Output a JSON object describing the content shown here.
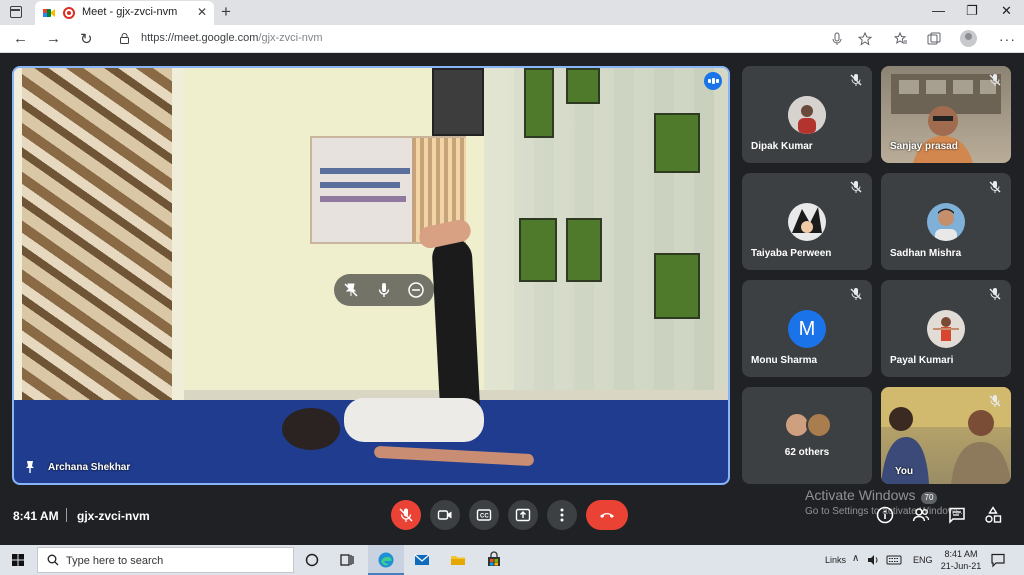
{
  "browser": {
    "tab_title": "Meet - gjx-zvci-nvm",
    "tab_close": "✕",
    "new_tab": "+",
    "url_host": "https://meet.google.com",
    "url_path": "/gjx-zvci-nvm",
    "window_controls": [
      "—",
      "❐",
      "✕"
    ]
  },
  "main_video": {
    "presenter_name": "Archana Shekhar"
  },
  "participants": [
    {
      "name": "Dipak Kumar",
      "muted": true,
      "avatar": "photo"
    },
    {
      "name": "Sanjay prasad",
      "muted": true,
      "avatar": "video"
    },
    {
      "name": "Taiyaba Perween",
      "muted": true,
      "avatar": "photo"
    },
    {
      "name": "Sadhan Mishra",
      "muted": true,
      "avatar": "photo"
    },
    {
      "name": "Monu Sharma",
      "muted": true,
      "avatar": "letter",
      "letter": "M"
    },
    {
      "name": "Payal Kumari",
      "muted": true,
      "avatar": "photo"
    },
    {
      "name": "62 others",
      "muted": false,
      "avatar": "group"
    },
    {
      "name": "You",
      "muted": true,
      "avatar": "video"
    }
  ],
  "meeting": {
    "time": "8:41 AM",
    "code": "gjx-zvci-nvm",
    "people_count": "70"
  },
  "watermark": {
    "line1": "Activate Windows",
    "line2": "Go to Settings to activate Windows."
  },
  "taskbar": {
    "search_placeholder": "Type here to search",
    "links_label": "Links",
    "lang": "ENG",
    "clock_time": "8:41 AM",
    "clock_date": "21-Jun-21"
  },
  "colors": {
    "accent": "#8ab4f8",
    "danger": "#ea4335",
    "surface": "#3c4043",
    "background": "#202124"
  }
}
